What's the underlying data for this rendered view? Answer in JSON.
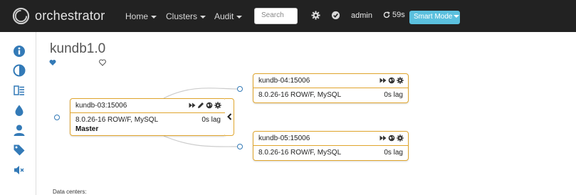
{
  "navbar": {
    "brand": "orchestrator",
    "menu": [
      {
        "label": "Home"
      },
      {
        "label": "Clusters"
      },
      {
        "label": "Audit"
      }
    ],
    "search_placeholder": "Search",
    "user": "admin",
    "refresh_label": "59s",
    "mode_button": "Smart Mode"
  },
  "sidebar": {
    "icons": [
      "info-icon",
      "contrast-icon",
      "list-icon",
      "drop-icon",
      "user-icon",
      "tag-icon",
      "mute-icon"
    ]
  },
  "cluster": {
    "title": "kundb1.0"
  },
  "instances": {
    "master": {
      "name": "kundb-03:15006",
      "version": "8.0.26-16 ROW/F, MySQL",
      "lag": "0s lag",
      "role": "Master"
    },
    "replica1": {
      "name": "kundb-04:15006",
      "version": "8.0.26-16 ROW/F, MySQL",
      "lag": "0s lag"
    },
    "replica2": {
      "name": "kundb-05:15006",
      "version": "8.0.26-16 ROW/F, MySQL",
      "lag": "0s lag"
    }
  },
  "footer": {
    "text": "Data centers:"
  },
  "colors": {
    "navbar_bg": "#222222",
    "accent": "#5bc0de",
    "instance_border": "#e0a52d",
    "sidebar_icon": "#337ab7"
  }
}
